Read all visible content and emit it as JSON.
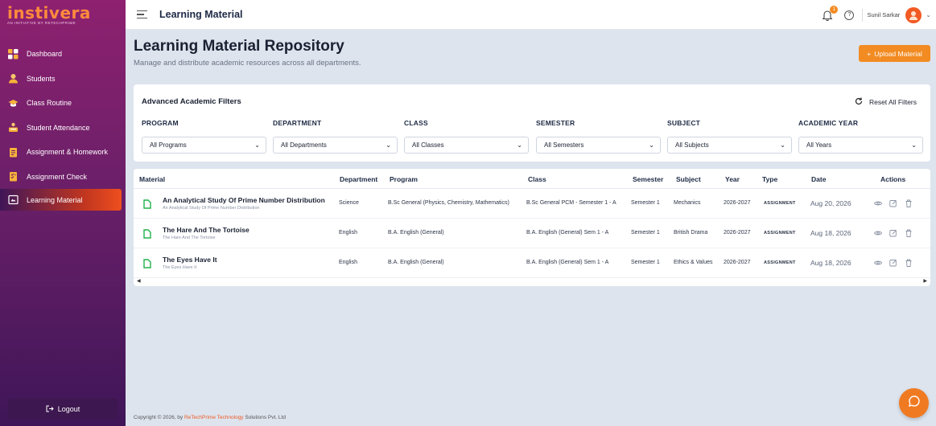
{
  "brand": {
    "logo": "instivera",
    "tagline": "AN INITIATIVE BY RETECHPRIME"
  },
  "sidebar": {
    "items": [
      {
        "label": "Dashboard",
        "icon": "dashboard-icon"
      },
      {
        "label": "Students",
        "icon": "students-icon"
      },
      {
        "label": "Class Routine",
        "icon": "graduation-cap-icon"
      },
      {
        "label": "Student Attendance",
        "icon": "attendance-icon"
      },
      {
        "label": "Assignment & Homework",
        "icon": "clipboard-icon"
      },
      {
        "label": "Assignment Check",
        "icon": "checklist-icon"
      },
      {
        "label": "Learning Material",
        "icon": "book-icon",
        "active": true
      }
    ],
    "logout": "Logout"
  },
  "header": {
    "title": "Learning Material",
    "notification_count": "1",
    "user_name": "Sunil Sarkar"
  },
  "page": {
    "title": "Learning Material Repository",
    "subtitle": "Manage and distribute academic resources across all departments.",
    "upload_button": "Upload Material"
  },
  "filters": {
    "title": "Advanced Academic Filters",
    "reset": "Reset All Filters",
    "fields": [
      {
        "label": "PROGRAM",
        "value": "All Programs"
      },
      {
        "label": "DEPARTMENT",
        "value": "All Departments"
      },
      {
        "label": "CLASS",
        "value": "All Classes"
      },
      {
        "label": "SEMESTER",
        "value": "All Semesters"
      },
      {
        "label": "SUBJECT",
        "value": "All Subjects"
      },
      {
        "label": "ACADEMIC YEAR",
        "value": "All Years"
      }
    ]
  },
  "table": {
    "columns": [
      "Material",
      "Department",
      "Program",
      "Class",
      "Semester",
      "Subject",
      "Year",
      "Type",
      "Date",
      "Actions"
    ],
    "rows": [
      {
        "title": "An Analytical Study Of Prime Number Distribution",
        "subtitle": "An Analytical Study Of Prime Number Distribution",
        "department": "Science",
        "program": "B.Sc General (Physics, Chemistry, Mathematics)",
        "class": "B.Sc General PCM - Semester 1 - A",
        "semester": "Semester 1",
        "subject": "Mechanics",
        "year": "2026-2027",
        "type": "ASSIGNMENT",
        "date": "Aug 20, 2026"
      },
      {
        "title": "The Hare And The Tortoise",
        "subtitle": "The Hare And The Tortoise",
        "department": "English",
        "program": "B.A. English (General)",
        "class": "B.A. English (General) Sem 1 - A",
        "semester": "Semester 1",
        "subject": "British Drama",
        "year": "2026-2027",
        "type": "ASSIGNMENT",
        "date": "Aug 18, 2026"
      },
      {
        "title": "The Eyes Have It",
        "subtitle": "The Eyes Have It",
        "department": "English",
        "program": "B.A. English (General)",
        "class": "B.A. English (General) Sem 1 - A",
        "semester": "Semester 1",
        "subject": "Ethics & Values",
        "year": "2026-2027",
        "type": "ASSIGNMENT",
        "date": "Aug 18, 2026"
      }
    ]
  },
  "footer": {
    "prefix": "Copyright © 2026, by ",
    "company": "ReTechPrime Technology",
    "suffix": " Solutions Pvt. Ltd"
  },
  "colors": {
    "accent": "#f28b22",
    "sidebar_top": "#8e2170",
    "sidebar_bottom": "#3f1658",
    "doc_icon": "#22b24c"
  }
}
